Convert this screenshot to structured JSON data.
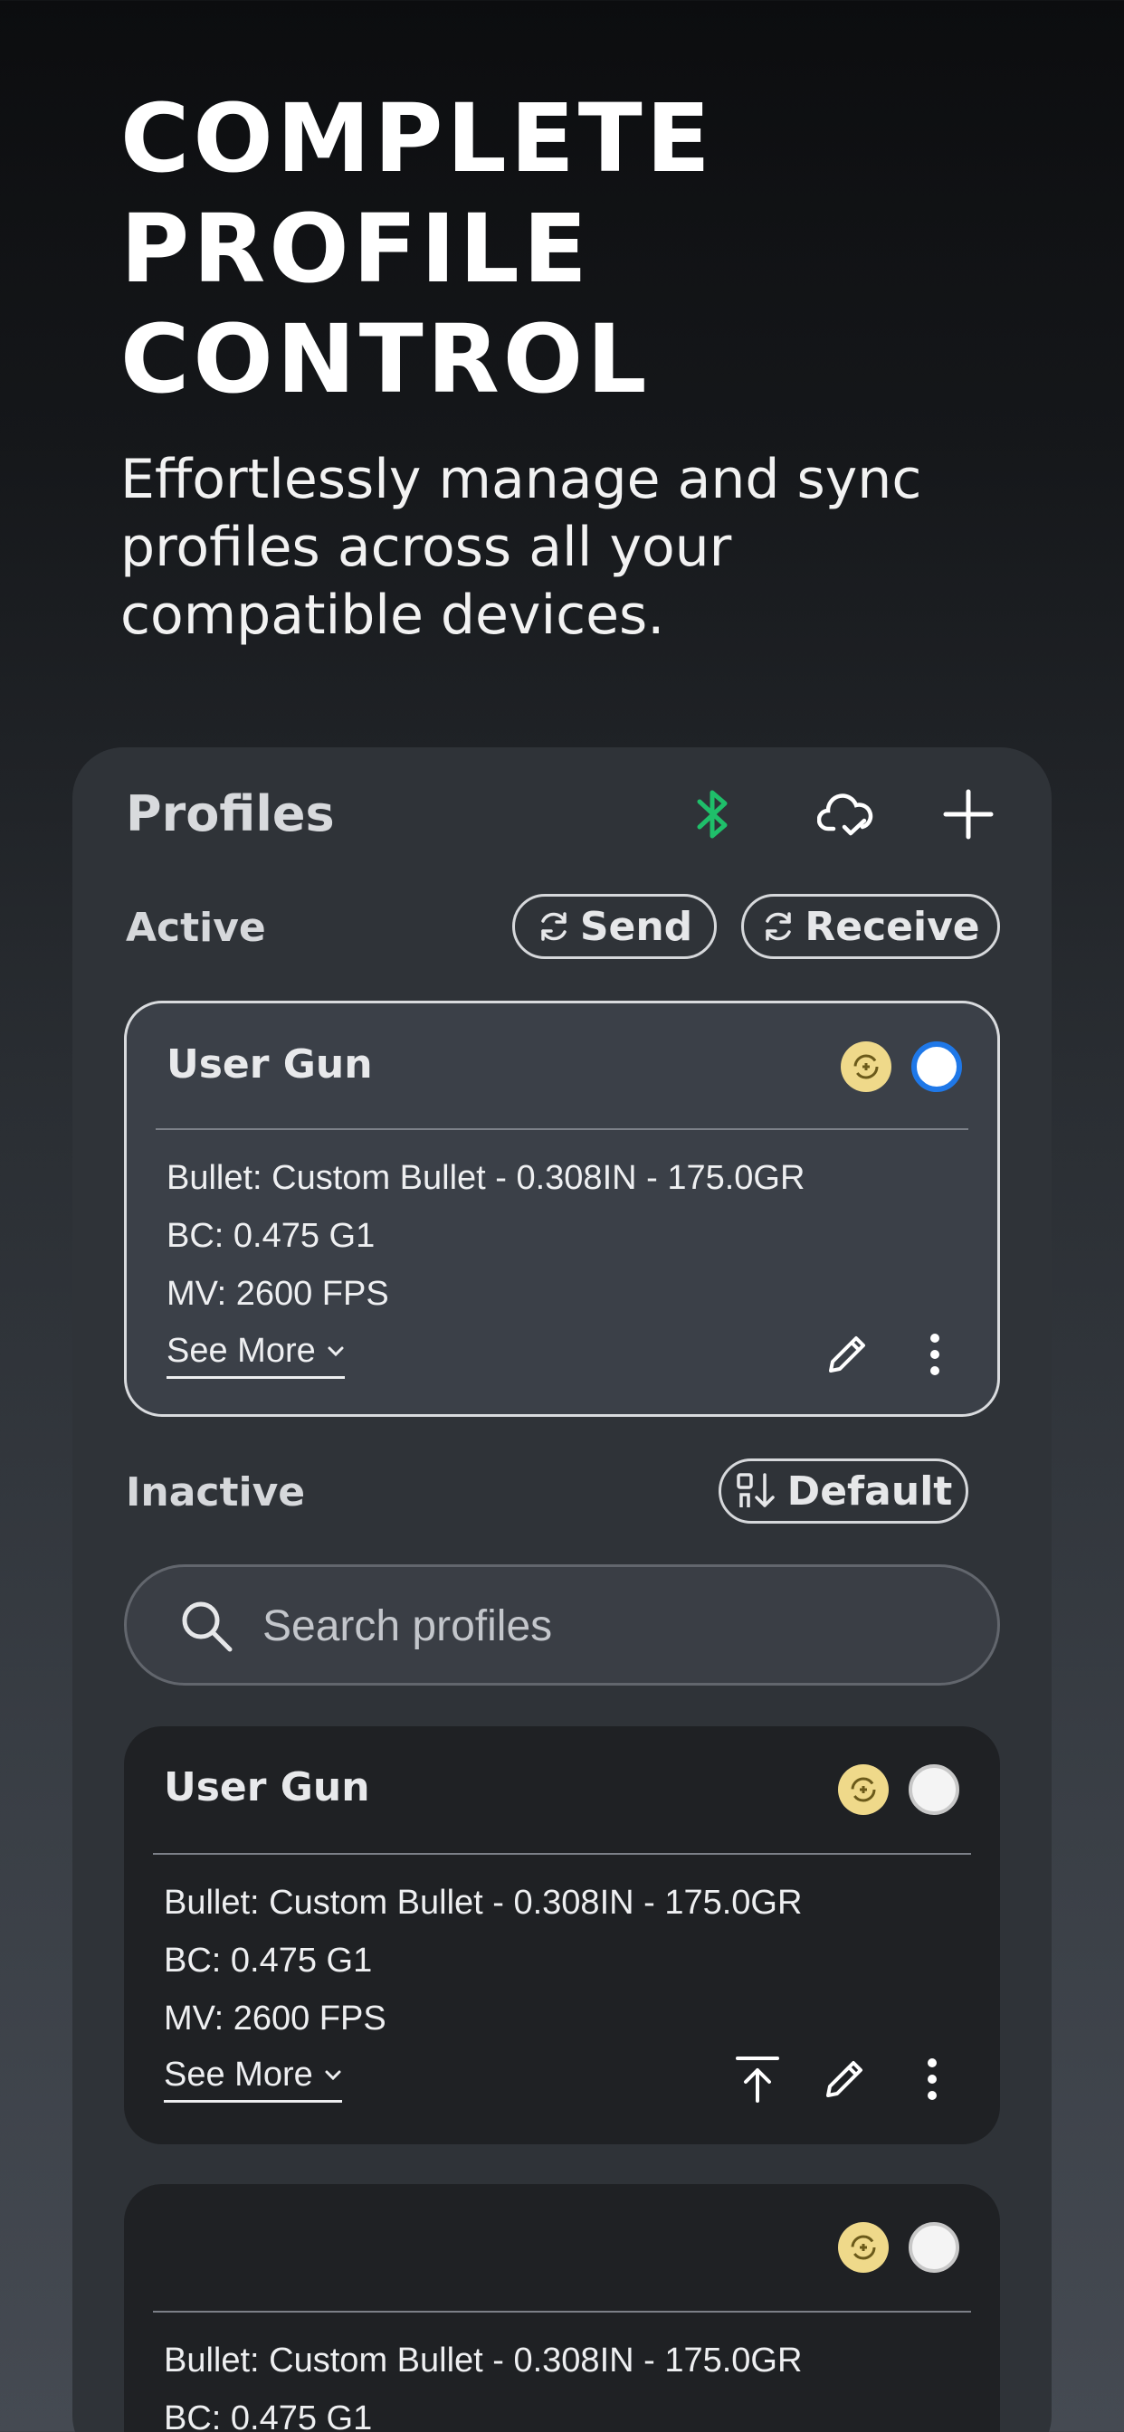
{
  "hero": {
    "title": "COMPLETE\nPROFILE\nCONTROL",
    "subtitle": "Effortlessly manage and sync profiles across all your compatible devices."
  },
  "header": {
    "title": "Profiles",
    "icons": [
      "bluetooth-icon",
      "cloud-check-icon",
      "plus-icon"
    ],
    "bluetooth_color": "#1fbf6a"
  },
  "active": {
    "label": "Active",
    "send_label": "Send",
    "receive_label": "Receive",
    "card": {
      "name": "User Gun",
      "bullet": "Bullet: Custom Bullet - 0.308IN - 175.0GR",
      "bc": "BC: 0.475 G1",
      "mv": "MV: 2600 FPS",
      "see_more": "See More"
    }
  },
  "inactive": {
    "label": "Inactive",
    "sort_label": "Default",
    "search_placeholder": "Search profiles",
    "cards": [
      {
        "name": "User Gun",
        "bullet": "Bullet: Custom Bullet - 0.308IN - 175.0GR",
        "bc": "BC: 0.475 G1",
        "mv": "MV: 2600 FPS",
        "see_more": "See More"
      },
      {
        "name": "",
        "bullet": "Bullet: Custom Bullet - 0.308IN - 175.0GR",
        "bc": "BC: 0.475 G1"
      }
    ]
  },
  "colors": {
    "accent_blue": "#1f78e8",
    "sync_badge": "#efd98a"
  }
}
